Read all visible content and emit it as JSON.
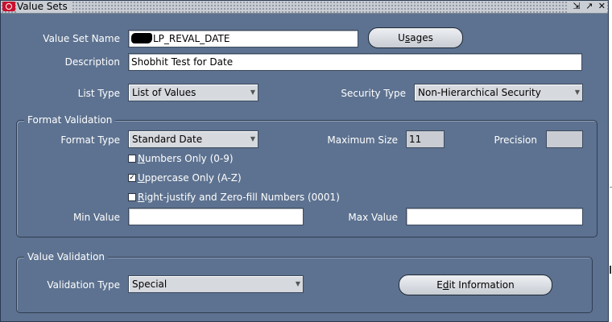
{
  "window": {
    "title": "Value Sets",
    "controls": [
      "⇲",
      "↗",
      "✕"
    ]
  },
  "fields": {
    "value_set_name": {
      "label": "Value Set Name",
      "value": "LP_REVAL_DATE"
    },
    "usages_button": "Usages",
    "description": {
      "label": "Description",
      "value": "Shobhit Test for Date"
    },
    "list_type": {
      "label": "List Type",
      "value": "List of Values"
    },
    "security_type": {
      "label": "Security Type",
      "value": "Non-Hierarchical Security"
    }
  },
  "format_validation": {
    "title": "Format Validation",
    "format_type": {
      "label": "Format Type",
      "value": "Standard Date"
    },
    "maximum_size": {
      "label": "Maximum Size",
      "value": "11"
    },
    "precision": {
      "label": "Precision",
      "value": ""
    },
    "numbers_only": {
      "label": "Numbers Only (0-9)",
      "checked": false
    },
    "uppercase_only": {
      "label": "Uppercase Only (A-Z)",
      "checked": true
    },
    "right_justify": {
      "label": "Right-justify and Zero-fill Numbers (0001)",
      "checked": false
    },
    "min_value": {
      "label": "Min Value",
      "value": ""
    },
    "max_value": {
      "label": "Max Value",
      "value": ""
    }
  },
  "value_validation": {
    "title": "Value Validation",
    "validation_type": {
      "label": "Validation Type",
      "value": "Special"
    },
    "edit_button": "Edit Information"
  },
  "glyphs": {
    "check": "✓",
    "dropdown": "▼"
  }
}
